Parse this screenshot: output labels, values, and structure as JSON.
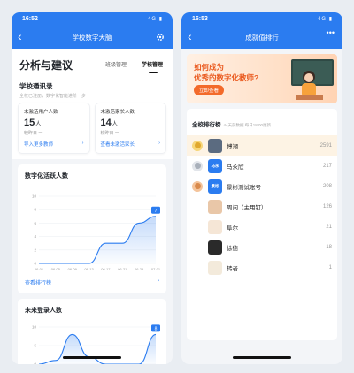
{
  "left": {
    "status_time": "16:52",
    "status_signal": "4G",
    "nav_title": "学校数字大脑",
    "page_title": "分析与建议",
    "tabs": [
      "班级管理",
      "学校管理"
    ],
    "active_tab": 1,
    "contacts": {
      "title": "学校通讯录",
      "subtitle": "全校已注册，数字化智能进阶一步",
      "cards": [
        {
          "label": "未激活用户人数",
          "value": "15",
          "unit": "人",
          "compare": "较昨日  一",
          "link": "导入更多教师"
        },
        {
          "label": "未激活家长人数",
          "value": "14",
          "unit": "人",
          "compare": "较昨日  一",
          "link": "查看未激活家长"
        }
      ]
    },
    "chart1": {
      "title": "数字化活跃人数",
      "link": "查看排行榜"
    },
    "chart2": {
      "title": "未来登录人数"
    }
  },
  "right": {
    "status_time": "16:53",
    "status_signal": "4G",
    "nav_title": "成就值排行",
    "banner": {
      "line1": "如何成为",
      "line2": "优秀的数字化教师?",
      "button": "立即查看"
    },
    "ranking": {
      "title": "全校排行榜",
      "subtitle": "44天前数据  每日18:00更新",
      "rows": [
        {
          "name": "博潮",
          "score": "2591",
          "medal": "gold",
          "avatar_text": "",
          "avatar_color": "#5b6b80",
          "highlight": true
        },
        {
          "name": "马永欣",
          "score": "217",
          "medal": "silver",
          "avatar_text": "马永",
          "avatar_color": "#2b7cf0",
          "highlight": false
        },
        {
          "name": "景彬测试账号",
          "score": "208",
          "medal": "bronze",
          "avatar_text": "景彬",
          "avatar_color": "#2b7cf0",
          "highlight": false
        },
        {
          "name": "周闲（主用钉）",
          "score": "126",
          "medal": "",
          "avatar_text": "",
          "avatar_color": "#e9c7a8",
          "highlight": false
        },
        {
          "name": "阜尔",
          "score": "21",
          "medal": "",
          "avatar_text": "",
          "avatar_color": "#f5e6d6",
          "highlight": false
        },
        {
          "name": "徐德",
          "score": "18",
          "medal": "",
          "avatar_text": "",
          "avatar_color": "#2a2a2a",
          "highlight": false
        },
        {
          "name": "转者",
          "score": "1",
          "medal": "",
          "avatar_text": "",
          "avatar_color": "#f3eadb",
          "highlight": false
        }
      ]
    }
  },
  "chart_data": [
    {
      "type": "area",
      "title": "数字化活跃人数",
      "x": [
        "06-01",
        "06-05",
        "06-09",
        "06-13",
        "06-17",
        "06-21",
        "06-25",
        "07-01"
      ],
      "series": [
        {
          "values": [
            0,
            0,
            0,
            0,
            3,
            3,
            6,
            7
          ]
        }
      ],
      "ylim": [
        0,
        10
      ],
      "yticks": [
        0,
        2,
        4,
        6,
        8,
        10
      ],
      "end_label": "7"
    },
    {
      "type": "area",
      "title": "未来登录人数",
      "x": [
        "06-01",
        "06-05",
        "06-09",
        "06-13",
        "06-17",
        "06-21",
        "06-25",
        "07-01"
      ],
      "series": [
        {
          "values": [
            0,
            1,
            8,
            2,
            0,
            0,
            0,
            8
          ]
        }
      ],
      "ylim": [
        0,
        10
      ],
      "yticks": [
        0,
        5,
        10
      ],
      "end_label": "8"
    }
  ],
  "colors": {
    "primary": "#2b7cf0",
    "banner_accent": "#ea5a1f"
  }
}
